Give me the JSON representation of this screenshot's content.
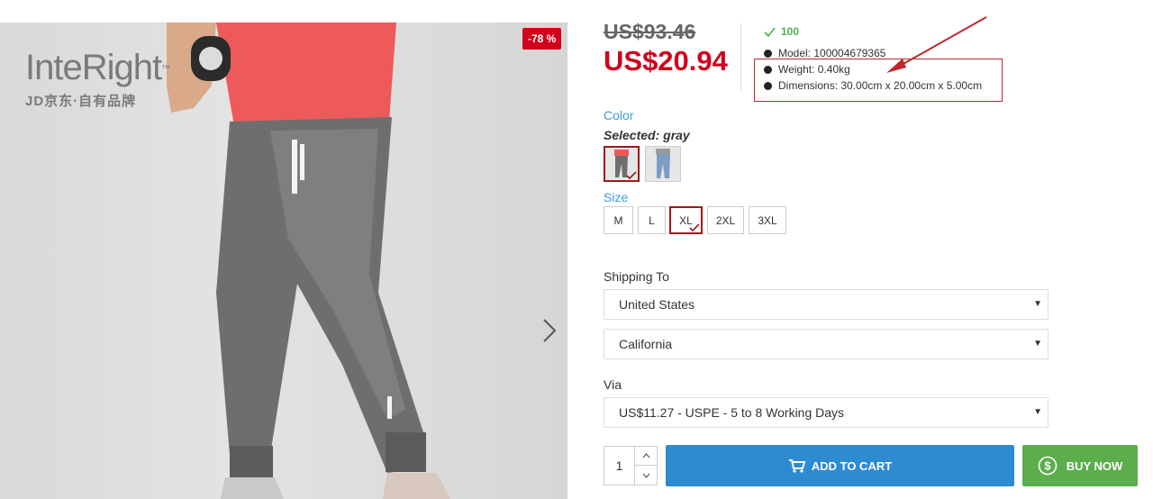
{
  "product_image": {
    "logo_text": "InteRight",
    "logo_tm": "™",
    "logo_sub": "JD京东·自有品牌",
    "discount": "-78 %",
    "next_icon": "chevron-right-icon"
  },
  "price": {
    "original": "US$93.46",
    "current": "US$20.94"
  },
  "stock": {
    "count": "100",
    "icon": "check-icon"
  },
  "specs": [
    "Model: 100004679365",
    "Weight: 0.40kg",
    "Dimensions: 30.00cm x 20.00cm x 5.00cm"
  ],
  "color": {
    "label": "Color",
    "selected_text": "Selected: gray",
    "options": [
      "gray",
      "blue"
    ]
  },
  "size": {
    "label": "Size",
    "options": [
      "M",
      "L",
      "XL",
      "2XL",
      "3XL"
    ],
    "selected": "XL"
  },
  "shipping": {
    "label": "Shipping To",
    "country": "United States",
    "state": "California",
    "via_label": "Via",
    "method": "US$11.27 - USPE - 5 to 8 Working Days"
  },
  "quantity": "1",
  "actions": {
    "add_to_cart": "ADD TO CART",
    "buy_now": "BUY NOW"
  },
  "colors": {
    "price_red": "#d0021b",
    "accent_blue": "#2d8bd2",
    "buy_green": "#5cad4c",
    "highlight_red": "#c0272d",
    "stock_green": "#4caf50"
  }
}
